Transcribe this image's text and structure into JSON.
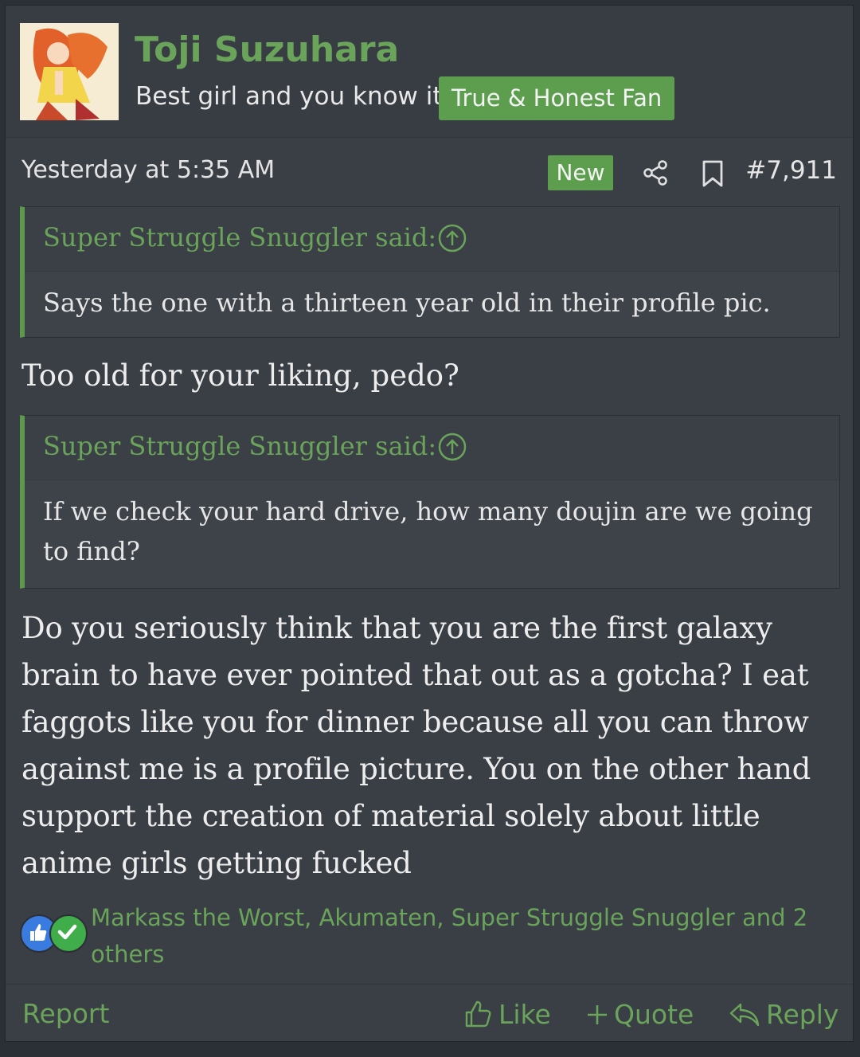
{
  "user": {
    "name": "Toji Suzuhara",
    "title": "Best girl and you know it",
    "banner": "True & Honest Fan"
  },
  "post": {
    "date": "Yesterday at 5:35 AM",
    "badge": "New",
    "number": "#7,911"
  },
  "quotes": [
    {
      "author": "Super Struggle Snuggler said:",
      "text": "Says the one with a thirteen year old in their profile pic."
    },
    {
      "author": "Super Struggle Snuggler said:",
      "text": "If we check your hard drive, how many doujin are we going to find?"
    }
  ],
  "messages": [
    "Too old for your liking, pedo?",
    "Do you seriously think that you are the first galaxy brain to have ever pointed that out as a gotcha? I eat faggots like you for dinner because all you can throw against me is a profile picture. You on the other hand support the creation of material solely about little anime girls getting fucked"
  ],
  "reactions": {
    "icons": [
      "thumbs-up-icon",
      "check-icon"
    ],
    "users": "Markass the Worst, Akumaten, Super Struggle Snuggler and 2 others"
  },
  "footer": {
    "report": "Report",
    "like": "Like",
    "quote": "Quote",
    "reply": "Reply"
  },
  "colors": {
    "accent": "#6aa35a",
    "badge": "#5d9e4e",
    "background": "#3a3e45",
    "like_reaction": "#3a7be0",
    "agree_reaction": "#3fae4a"
  }
}
